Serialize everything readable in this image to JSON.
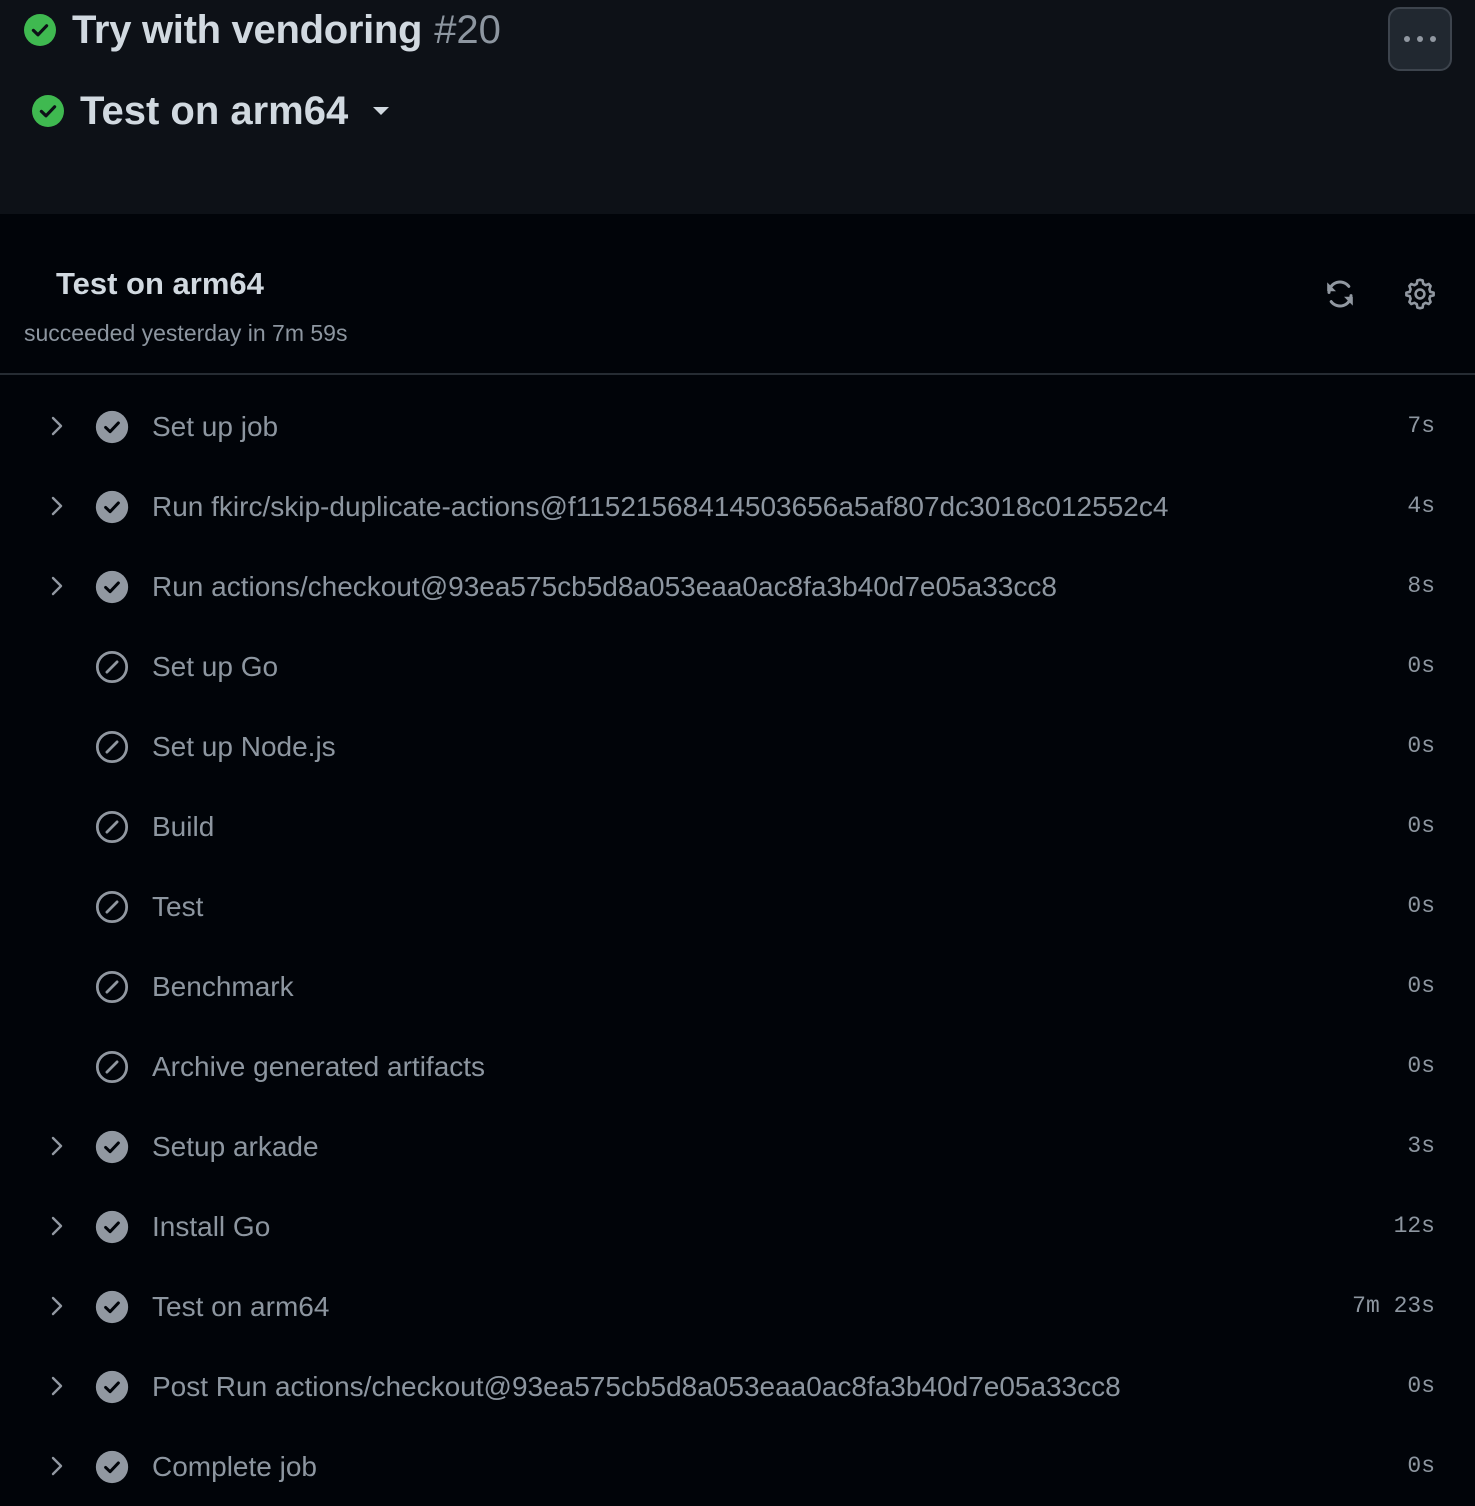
{
  "colors": {
    "success": "#3fb950",
    "muted": "#8d96a0",
    "text": "#d1d9e0",
    "header_bg": "#0d1117",
    "panel_bg": "#010409"
  },
  "header": {
    "run_title": "Try with vendoring",
    "run_number": "#20",
    "run_status_icon": "check-circle-fill-icon",
    "job_title": "Test on arm64",
    "job_status_icon": "check-circle-fill-icon",
    "job_dropdown_icon": "triangle-down-icon",
    "more_icon": "kebab-horizontal-icon"
  },
  "job": {
    "name": "Test on arm64",
    "summary": "succeeded yesterday in 7m 59s",
    "rerun_icon": "sync-icon",
    "settings_icon": "gear-icon"
  },
  "steps": [
    {
      "name": "Set up job",
      "duration": "7s",
      "status": "success",
      "expandable": true
    },
    {
      "name": "Run fkirc/skip-duplicate-actions@f11521568414503656a5af807dc3018c012552c4",
      "duration": "4s",
      "status": "success",
      "expandable": true
    },
    {
      "name": "Run actions/checkout@93ea575cb5d8a053eaa0ac8fa3b40d7e05a33cc8",
      "duration": "8s",
      "status": "success",
      "expandable": true
    },
    {
      "name": "Set up Go",
      "duration": "0s",
      "status": "skipped",
      "expandable": false
    },
    {
      "name": "Set up Node.js",
      "duration": "0s",
      "status": "skipped",
      "expandable": false
    },
    {
      "name": "Build",
      "duration": "0s",
      "status": "skipped",
      "expandable": false
    },
    {
      "name": "Test",
      "duration": "0s",
      "status": "skipped",
      "expandable": false
    },
    {
      "name": "Benchmark",
      "duration": "0s",
      "status": "skipped",
      "expandable": false
    },
    {
      "name": "Archive generated artifacts",
      "duration": "0s",
      "status": "skipped",
      "expandable": false
    },
    {
      "name": "Setup arkade",
      "duration": "3s",
      "status": "success",
      "expandable": true
    },
    {
      "name": "Install Go",
      "duration": "12s",
      "status": "success",
      "expandable": true
    },
    {
      "name": "Test on arm64",
      "duration": "7m 23s",
      "status": "success",
      "expandable": true
    },
    {
      "name": "Post Run actions/checkout@93ea575cb5d8a053eaa0ac8fa3b40d7e05a33cc8",
      "duration": "0s",
      "status": "success",
      "expandable": true
    },
    {
      "name": "Complete job",
      "duration": "0s",
      "status": "success",
      "expandable": true
    }
  ]
}
